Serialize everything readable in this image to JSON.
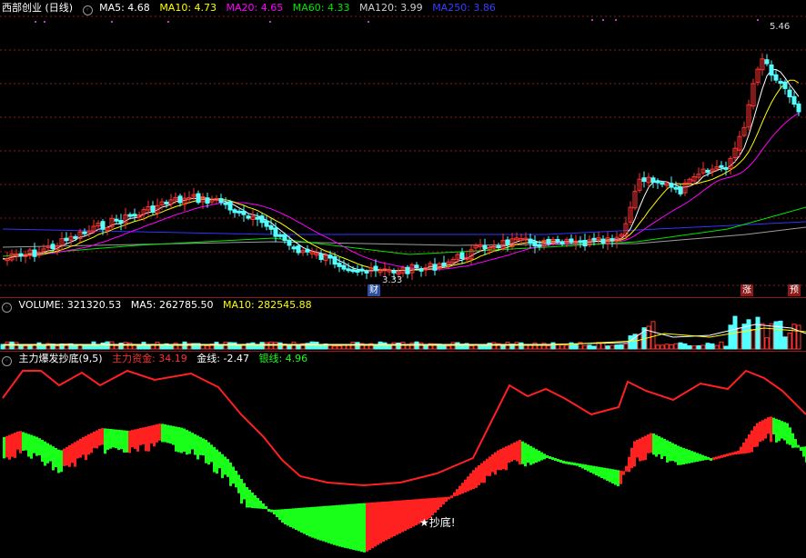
{
  "main": {
    "title": "西部创业 (日线)",
    "ma5": "MA5: 4.68",
    "ma10": "MA10: 4.73",
    "ma20": "MA20: 4.65",
    "ma60": "MA60: 4.33",
    "ma120": "MA120: 3.99",
    "ma250": "MA250: 3.86",
    "high_label": "5.46",
    "low_label": "3.33",
    "marker_cai": "财",
    "marker_zhang": "涨",
    "marker_yu": "预"
  },
  "volume": {
    "label": "VOLUME: 321320.53",
    "ma5": "MA5: 262785.50",
    "ma10": "MA10: 282545.88"
  },
  "indicator": {
    "name": "主力爆发抄底(9,5)",
    "main_funds": "主力资金: 34.19",
    "gold_line": "金线: -2.47",
    "silver_line": "银线: 4.96",
    "signal": "★抄底!"
  },
  "colors": {
    "up": "#ff3232",
    "down": "#54ffff",
    "ma5": "#ffffff",
    "ma10": "#ffff00",
    "ma20": "#ff00ff",
    "ma60": "#00e600",
    "ma120": "#9e9e9e",
    "ma250": "#3333ff",
    "ind_red": "#ff2020",
    "ind_green": "#19ff19"
  }
}
